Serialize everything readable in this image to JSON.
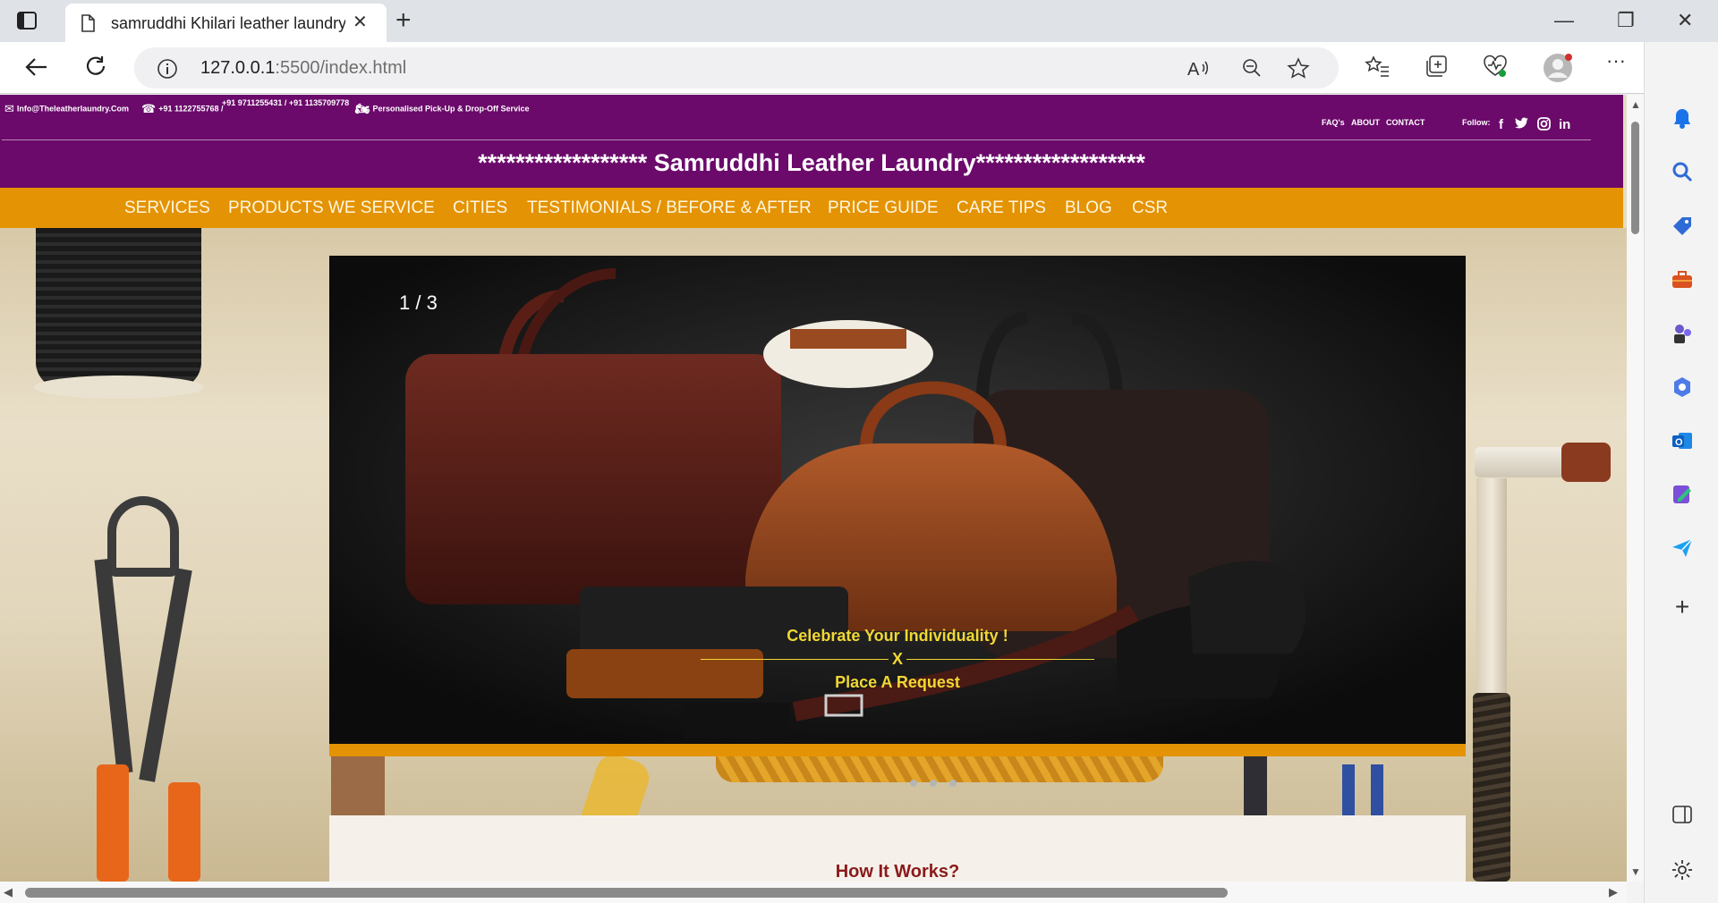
{
  "browser": {
    "tab_title": "samruddhi Khilari leather laundry",
    "url_host": "127.0.0.1",
    "url_rest": ":5500/index.html"
  },
  "site": {
    "email": "Info@Theleatherlaundry.Com",
    "phone1": "+91 1122755768 /",
    "phone2": "+91 9711255431 / +91 1135709778",
    "pickup": "Personalised Pick-Up & Drop-Off Service",
    "top_links": [
      "FAQ's",
      "ABOUT",
      "CONTACT"
    ],
    "follow_label": "Follow:",
    "brand": "****************** Samruddhi Leather Laundry******************",
    "menu": [
      "SERVICES",
      "PRODUCTS WE SERVICE",
      "CITIES",
      "TESTIMONIALS / BEFORE & AFTER",
      "PRICE GUIDE",
      "CARE TIPS",
      "BLOG",
      "CSR"
    ],
    "slider": {
      "counter": "1 / 3",
      "caption_line1": "Celebrate Your Individuality !",
      "caption_mid": "X",
      "caption_line3": "Place A Request"
    },
    "how_title": "How It Works?"
  },
  "colors": {
    "topbar": "#6b0a6b",
    "menu": "#e49304",
    "caption": "#f1d734",
    "how_title": "#8a1a1a"
  }
}
